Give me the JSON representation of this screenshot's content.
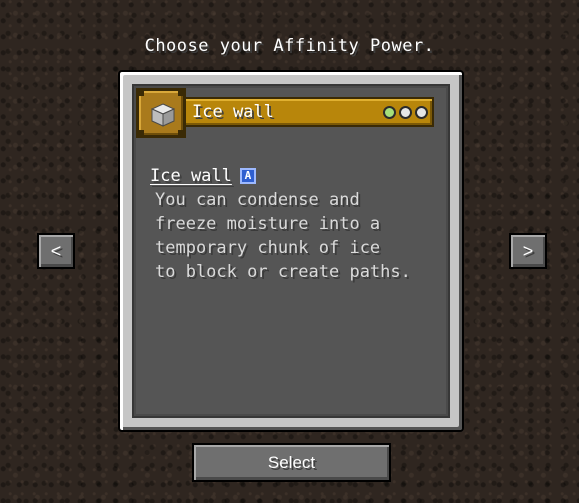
{
  "screen": {
    "title": "Choose your Affinity Power."
  },
  "power": {
    "banner_label": "Ice wall",
    "icon": "ice-block-icon",
    "tiers": [
      {
        "state": "active",
        "color": "#a6e07a"
      },
      {
        "state": "inactive",
        "color": "#e6e6e6"
      },
      {
        "state": "inactive",
        "color": "#e6e6e6"
      }
    ],
    "name": "Ice wall",
    "badge": "A",
    "description": [
      "You can condense and",
      "freeze moisture into a",
      "temporary chunk of ice",
      "to block or create paths."
    ]
  },
  "nav": {
    "prev_label": "<",
    "prev_icon": "chevron-left-icon",
    "next_label": ">",
    "next_icon": "chevron-right-icon"
  },
  "actions": {
    "select_label": "Select"
  },
  "colors": {
    "banner_gold": "#b8860b",
    "badge_blue": "#2f5fd0",
    "panel_dark": "#555555"
  }
}
